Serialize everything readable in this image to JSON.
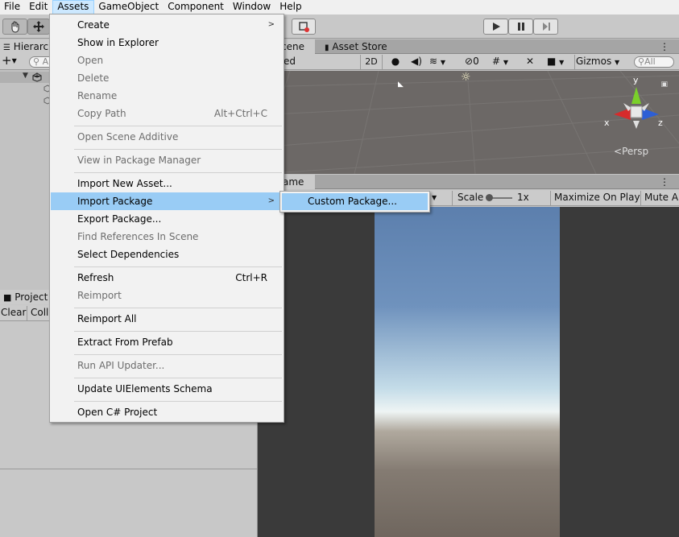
{
  "menubar": {
    "items": [
      {
        "label": "File"
      },
      {
        "label": "Edit"
      },
      {
        "label": "Assets"
      },
      {
        "label": "GameObject"
      },
      {
        "label": "Component"
      },
      {
        "label": "Window"
      },
      {
        "label": "Help"
      }
    ]
  },
  "toolbar": {
    "tools": [
      "hand-tool",
      "move-tool"
    ],
    "play_controls": [
      "play",
      "pause",
      "step"
    ]
  },
  "hierarchy": {
    "tab_label": "Hierarc",
    "add_label": "+",
    "search_placeholder": "A"
  },
  "scene": {
    "tab_label": "cene",
    "asset_store_label": "Asset Store",
    "shading_label": "ed",
    "mode_2d": "2D",
    "hidden_count": "0",
    "gizmos_label": "Gizmos",
    "search_placeholder": "All",
    "gizmo": {
      "x": "x",
      "y": "y",
      "z": "z",
      "persp": "Persp"
    }
  },
  "game": {
    "tab_label": "ame",
    "scale_label": "Scale",
    "scale_value": "1x",
    "maximize_label": "Maximize On Play",
    "mute_label": "Mute A"
  },
  "project": {
    "tab_label": "Project"
  },
  "console": {
    "clear_label": "Clear",
    "collapse_label": "Coll"
  },
  "assets_menu": {
    "items": [
      {
        "label": "Create",
        "submenu": true,
        "enabled": true
      },
      {
        "label": "Show in Explorer",
        "enabled": true
      },
      {
        "label": "Open",
        "enabled": false
      },
      {
        "label": "Delete",
        "enabled": false
      },
      {
        "label": "Rename",
        "enabled": false
      },
      {
        "label": "Copy Path",
        "shortcut": "Alt+Ctrl+C",
        "enabled": false
      },
      {
        "label": "Open Scene Additive",
        "enabled": false
      },
      {
        "label": "View in Package Manager",
        "enabled": false
      },
      {
        "label": "Import New Asset...",
        "enabled": true
      },
      {
        "label": "Import Package",
        "submenu": true,
        "enabled": true,
        "highlighted": true
      },
      {
        "label": "Export Package...",
        "enabled": true
      },
      {
        "label": "Find References In Scene",
        "enabled": false
      },
      {
        "label": "Select Dependencies",
        "enabled": true
      },
      {
        "label": "Refresh",
        "shortcut": "Ctrl+R",
        "enabled": true
      },
      {
        "label": "Reimport",
        "enabled": false
      },
      {
        "label": "Reimport All",
        "enabled": true
      },
      {
        "label": "Extract From Prefab",
        "enabled": true
      },
      {
        "label": "Run API Updater...",
        "enabled": false
      },
      {
        "label": "Update UIElements Schema",
        "enabled": true
      },
      {
        "label": "Open C# Project",
        "enabled": true
      }
    ]
  },
  "import_package_submenu": {
    "items": [
      {
        "label": "Custom Package..."
      }
    ]
  },
  "colors": {
    "menu_highlight": "#99ccf5",
    "active_menu": "#cce8ff",
    "gizmo_x": "#d62b2b",
    "gizmo_y": "#7ad02a",
    "gizmo_z": "#2d5fd6"
  }
}
